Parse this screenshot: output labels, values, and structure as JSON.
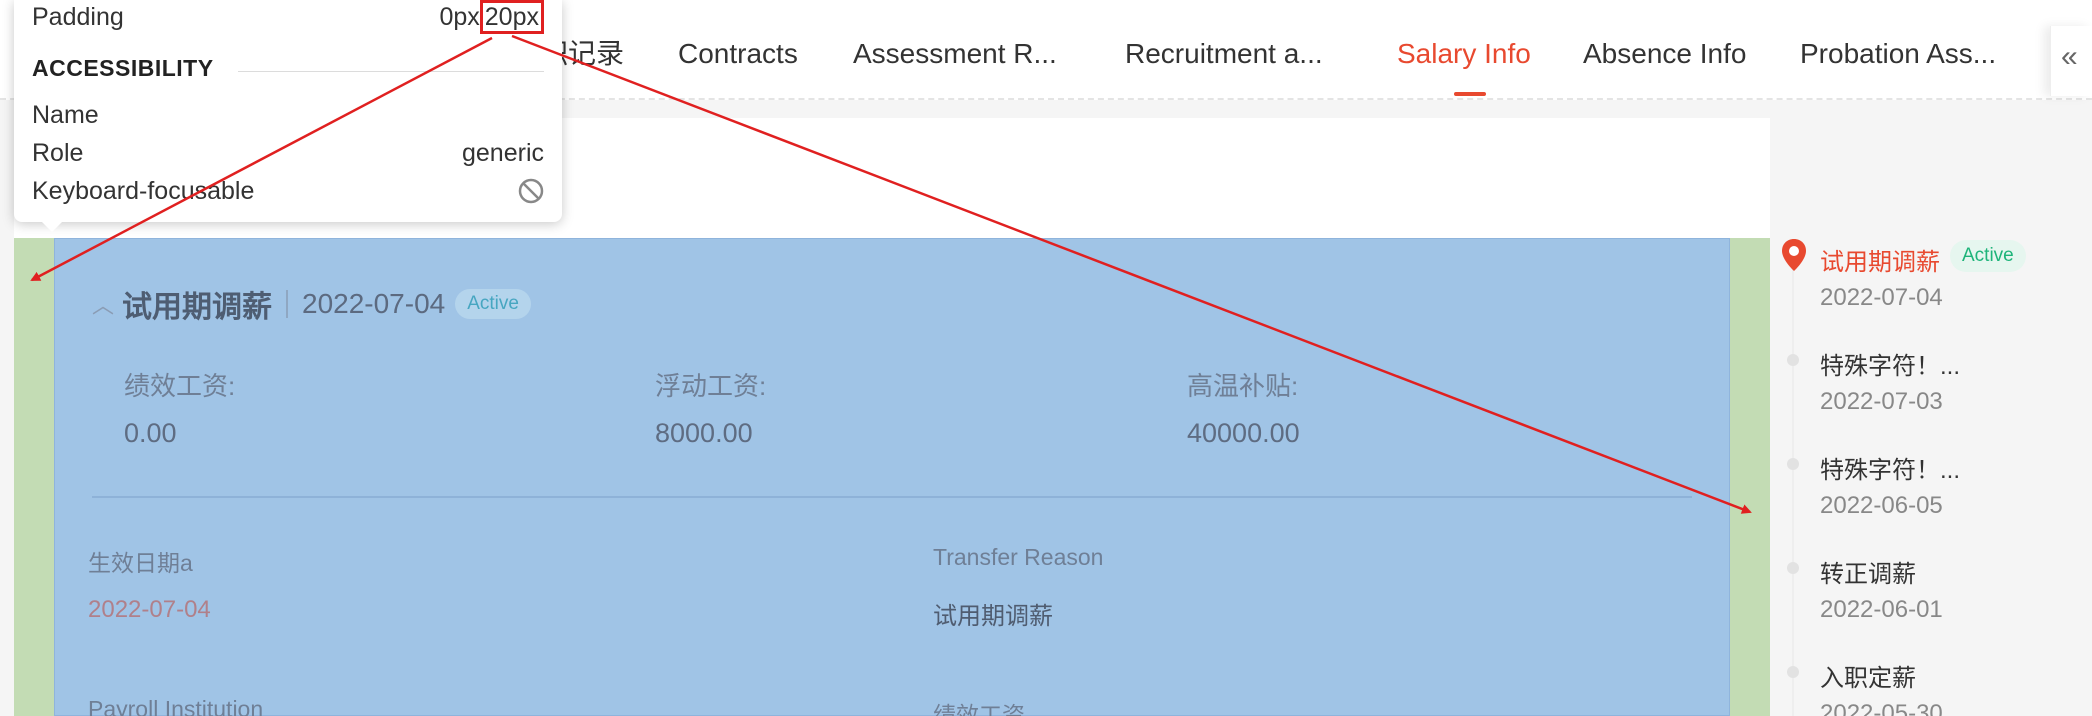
{
  "tabs": [
    {
      "label": "职记录"
    },
    {
      "label": "Contracts"
    },
    {
      "label": "Assessment R..."
    },
    {
      "label": "Recruitment a..."
    },
    {
      "label": "Salary Info"
    },
    {
      "label": "Absence Info"
    },
    {
      "label": "Probation Ass..."
    }
  ],
  "tab_scroll_icon": "«",
  "tooltip": {
    "padding_label": "Padding",
    "padding_value_a": "0px",
    "padding_value_b": "20px",
    "accessibility_heading": "ACCESSIBILITY",
    "name_label": "Name",
    "role_label": "Role",
    "role_value": "generic",
    "focusable_label": "Keyboard-focusable",
    "focusable_icon": "not-allowed-icon"
  },
  "section": {
    "title": "试用期调薪",
    "date": "2022-07-04",
    "status": "Active",
    "fields": [
      {
        "label": "绩效工资:",
        "value": "0.00"
      },
      {
        "label": "浮动工资:",
        "value": "8000.00"
      },
      {
        "label": "高温补贴:",
        "value": "40000.00"
      }
    ],
    "details": [
      {
        "label": "生效日期a",
        "value": "2022-07-04"
      },
      {
        "label": "Transfer Reason",
        "value": "试用期调薪"
      },
      {
        "label": "Payroll Institution",
        "value": ""
      },
      {
        "label": "绩效工资",
        "value": ""
      }
    ]
  },
  "timeline": [
    {
      "title": "试用期调薪",
      "date": "2022-07-04",
      "badge": "Active",
      "active": true
    },
    {
      "title": "特殊字符！...",
      "date": "2022-07-03"
    },
    {
      "title": "特殊字符！...",
      "date": "2022-06-05"
    },
    {
      "title": "转正调薪",
      "date": "2022-06-01"
    },
    {
      "title": "入职定薪",
      "date": "2022-05-30"
    }
  ],
  "colors": {
    "accent": "#e8492f",
    "active_green": "#1fb47a",
    "padding_overlay": "#c3dcb4",
    "content_overlay": "#a0c4e6",
    "annotation_red": "#e02020"
  }
}
